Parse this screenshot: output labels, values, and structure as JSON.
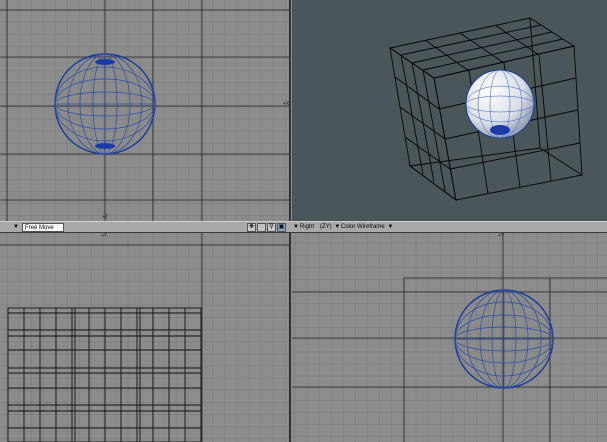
{
  "toolbar_left": {
    "menu_icon": "triangle-down-icon",
    "mode_value": "Free Move",
    "buttons": [
      {
        "name": "move-icon",
        "glyph": "✥",
        "active": false
      },
      {
        "name": "rotate-icon",
        "glyph": "◌",
        "active": false
      },
      {
        "name": "zoom-icon",
        "glyph": "⚲",
        "active": false
      },
      {
        "name": "maximize-icon",
        "glyph": "▣",
        "active": true
      }
    ]
  },
  "toolbar_right": {
    "view_label": "Right",
    "axis_label": "(ZY)",
    "render_mode": "Color Wireframe"
  },
  "axis_labels": {
    "top_x": "+X",
    "top_z": "+Z",
    "front_y": "+Y",
    "right_y": "+Y",
    "right_z": "+Z"
  },
  "colors": {
    "grid_bg": "#8c8c8c",
    "grid_line": "#7d7d7d",
    "major_line": "#1e1e1e",
    "sphere_wire": "#1a3a9a",
    "persp_bg": "#4a5659"
  }
}
